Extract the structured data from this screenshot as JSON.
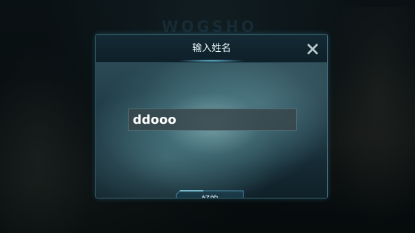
{
  "background": {
    "logo_text": "WOGSHO"
  },
  "dialog": {
    "title": "输入姓名",
    "close_icon": "close-icon",
    "input": {
      "value": "ddooo",
      "placeholder": ""
    },
    "confirm_label": "好的"
  },
  "colors": {
    "accent": "#6fd2f0",
    "title_text": "#e8f4f8",
    "border": "#3e6a78"
  }
}
